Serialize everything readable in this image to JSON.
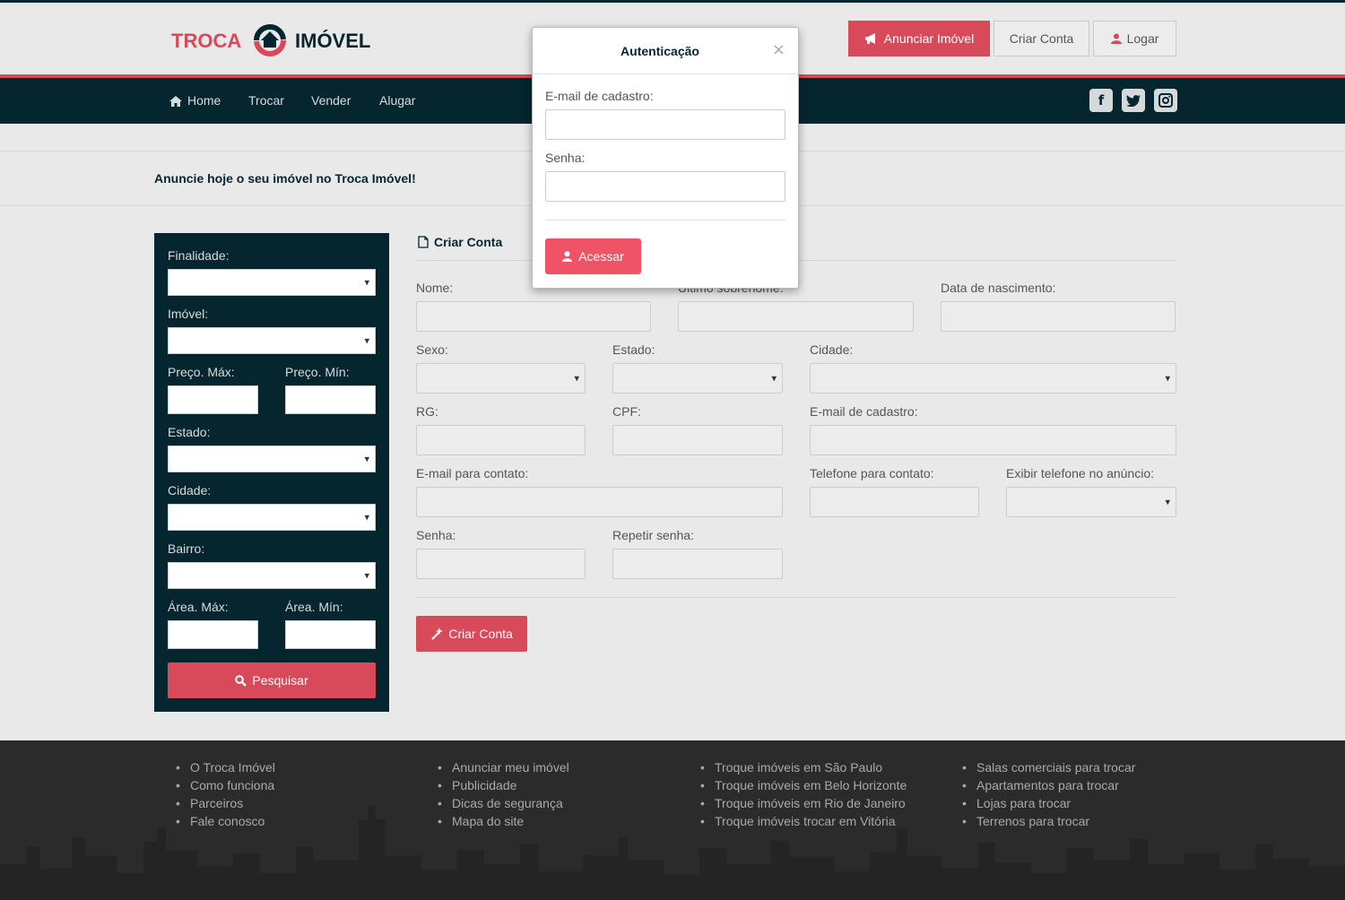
{
  "brand": {
    "logo_left": "TROCA",
    "logo_right": "IMÓVEL"
  },
  "header": {
    "advertise_label": "Anunciar Imóvel",
    "create_account_label": "Criar Conta",
    "login_label": "Logar"
  },
  "nav": {
    "items": [
      {
        "label": "Home",
        "icon": "home-icon"
      },
      {
        "label": "Trocar"
      },
      {
        "label": "Vender"
      },
      {
        "label": "Alugar"
      }
    ],
    "social": [
      "facebook-icon",
      "twitter-icon",
      "instagram-icon"
    ]
  },
  "banner": {
    "text": "Anuncie hoje o seu imóvel no Troca Imóvel!"
  },
  "search": {
    "finalidade": "Finalidade:",
    "imovel": "Imóvel:",
    "preco_max": "Preço. Máx:",
    "preco_min": "Preço. Mín:",
    "estado": "Estado:",
    "cidade": "Cidade:",
    "bairro": "Bairro:",
    "area_max": "Área. Máx:",
    "area_min": "Área. Mín:",
    "button": "Pesquisar"
  },
  "form": {
    "title": "Criar Conta",
    "nome": "Nome:",
    "sobrenome": "Último sobrenome:",
    "nascimento": "Data de nascimento:",
    "sexo": "Sexo:",
    "estado": "Estado:",
    "cidade": "Cidade:",
    "rg": "RG:",
    "cpf": "CPF:",
    "email_cadastro": "E-mail de cadastro:",
    "email_contato": "E-mail para contato:",
    "telefone": "Telefone para contato:",
    "exibir_telefone": "Exibir telefone no anúncio:",
    "senha": "Senha:",
    "repetir_senha": "Repetir senha:",
    "submit": "Criar Conta"
  },
  "modal": {
    "title": "Autenticação",
    "close": "×",
    "email_label": "E-mail de cadastro:",
    "email_value": "",
    "password_label": "Senha:",
    "password_value": "",
    "submit": "Acessar"
  },
  "footer": {
    "col1": [
      "O Troca Imóvel",
      "Como funciona",
      "Parceiros",
      "Fale conosco"
    ],
    "col2": [
      "Anunciar meu imóvel",
      "Publicidade",
      "Dicas de segurança",
      "Mapa do site"
    ],
    "col3": [
      "Troque imóveis em São Paulo",
      "Troque imóveis em Belo Horizonte",
      "Troque imóveis em Rio de Janeiro",
      "Troque imóveis trocar em Vitória"
    ],
    "col4": [
      "Salas comerciais para trocar",
      "Apartamentos para trocar",
      "Lojas para trocar",
      "Terrenos para trocar"
    ]
  },
  "colors": {
    "brand_red": "#d8495a",
    "brand_dark": "#05262e",
    "button_red": "#ef5466",
    "footer_bg": "#2b2b2b"
  }
}
